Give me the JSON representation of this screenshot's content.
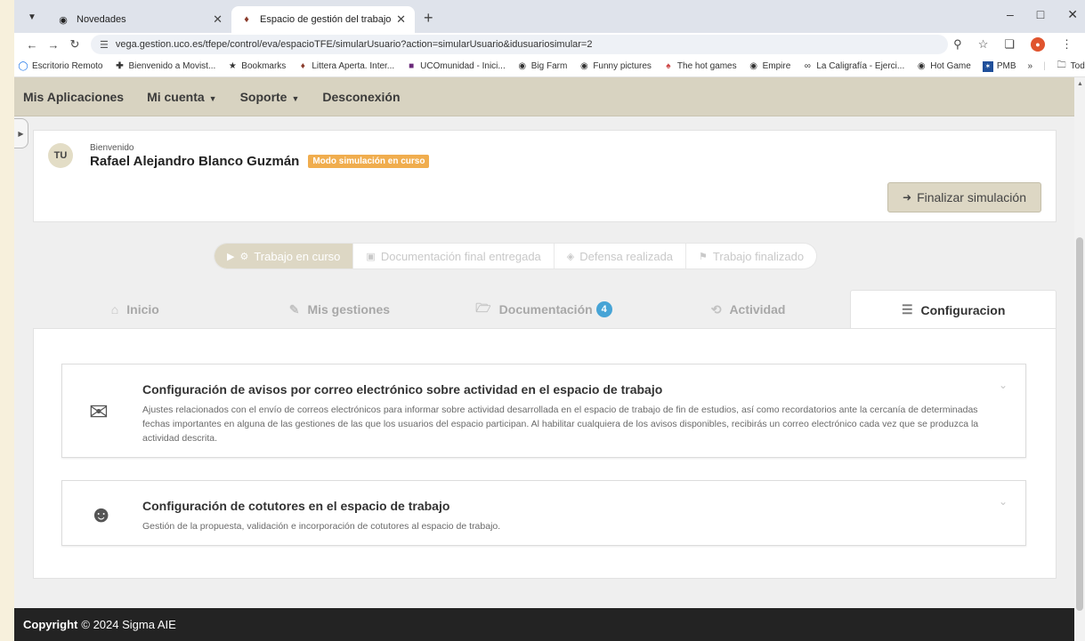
{
  "browser": {
    "tabs": [
      {
        "title": "Novedades",
        "active": false
      },
      {
        "title": "Espacio de gestión del trabajo d",
        "active": true
      }
    ],
    "url": "vega.gestion.uco.es/tfepe/control/eva/espacioTFE/simularUsuario?action=simularUsuario&idusuariosimular=2",
    "bookmarks": [
      {
        "label": "Escritorio Remoto",
        "icon": "remote-desktop-icon"
      },
      {
        "label": "Bienvenido a Movist...",
        "icon": "movistar-icon"
      },
      {
        "label": "Bookmarks",
        "icon": "star-icon"
      },
      {
        "label": "Littera Aperta. Inter...",
        "icon": "littera-icon"
      },
      {
        "label": "UCOmunidad - Inici...",
        "icon": "uco-icon"
      },
      {
        "label": "Big Farm",
        "icon": "globe-icon"
      },
      {
        "label": "Funny pictures",
        "icon": "globe-icon"
      },
      {
        "label": "The hot games",
        "icon": "game-icon"
      },
      {
        "label": "Empire",
        "icon": "globe-icon"
      },
      {
        "label": "La Caligrafía - Ejerci...",
        "icon": "caligrafia-icon"
      },
      {
        "label": "Hot Game",
        "icon": "globe-icon"
      },
      {
        "label": "PMB",
        "icon": "pmb-icon"
      }
    ],
    "bookmarks_overflow": "»",
    "all_bookmarks": "Todos los marcadores"
  },
  "nav": {
    "mis_aplicaciones": "Mis Aplicaciones",
    "mi_cuenta": "Mi cuenta",
    "soporte": "Soporte",
    "desconexion": "Desconexión"
  },
  "welcome": {
    "avatar": "TU",
    "greeting": "Bienvenido",
    "user_name": "Rafael Alejandro Blanco Guzmán",
    "badge": "Modo simulación en curso",
    "finish_button": "Finalizar simulación"
  },
  "steps": [
    {
      "label": "Trabajo en curso",
      "icon": "cogs-icon",
      "active": true
    },
    {
      "label": "Documentación final entregada",
      "icon": "inbox-icon",
      "active": false
    },
    {
      "label": "Defensa realizada",
      "icon": "presentation-icon",
      "active": false
    },
    {
      "label": "Trabajo finalizado",
      "icon": "flag-icon",
      "active": false
    }
  ],
  "page_tabs": [
    {
      "label": "Inicio",
      "icon": "home-icon",
      "active": false
    },
    {
      "label": "Mis gestiones",
      "icon": "edit-icon",
      "active": false
    },
    {
      "label": "Documentación",
      "icon": "folder-open-icon",
      "badge": "4",
      "active": false
    },
    {
      "label": "Actividad",
      "icon": "history-icon",
      "active": false
    },
    {
      "label": "Configuracion",
      "icon": "sliders-icon",
      "active": true
    }
  ],
  "cards": [
    {
      "title": "Configuración de avisos por correo electrónico sobre actividad en el espacio de trabajo",
      "description": "Ajustes relacionados con el envío de correos electrónicos para informar sobre actividad desarrollada en el espacio de trabajo de fin de estudios, así como recordatorios ante la cercanía de determinadas fechas importantes en alguna de las gestiones de las que los usuarios del espacio participan. Al habilitar cualquiera de los avisos disponibles, recibirás un correo electrónico cada vez que se produzca la actividad descrita.",
      "icon": "envelope-icon"
    },
    {
      "title": "Configuración de cotutores en el espacio de trabajo",
      "description": "Gestión de la propuesta, validación e incorporación de cotutores al espacio de trabajo.",
      "icon": "users-icon"
    }
  ],
  "footer": {
    "copyright_label": "Copyright",
    "copyright_text": "© 2024 Sigma AIE"
  },
  "colors": {
    "nav_bg": "#d8d3c1",
    "badge_orange": "#f0ad4e",
    "count_blue": "#47a4d6",
    "footer_bg": "#232323"
  }
}
